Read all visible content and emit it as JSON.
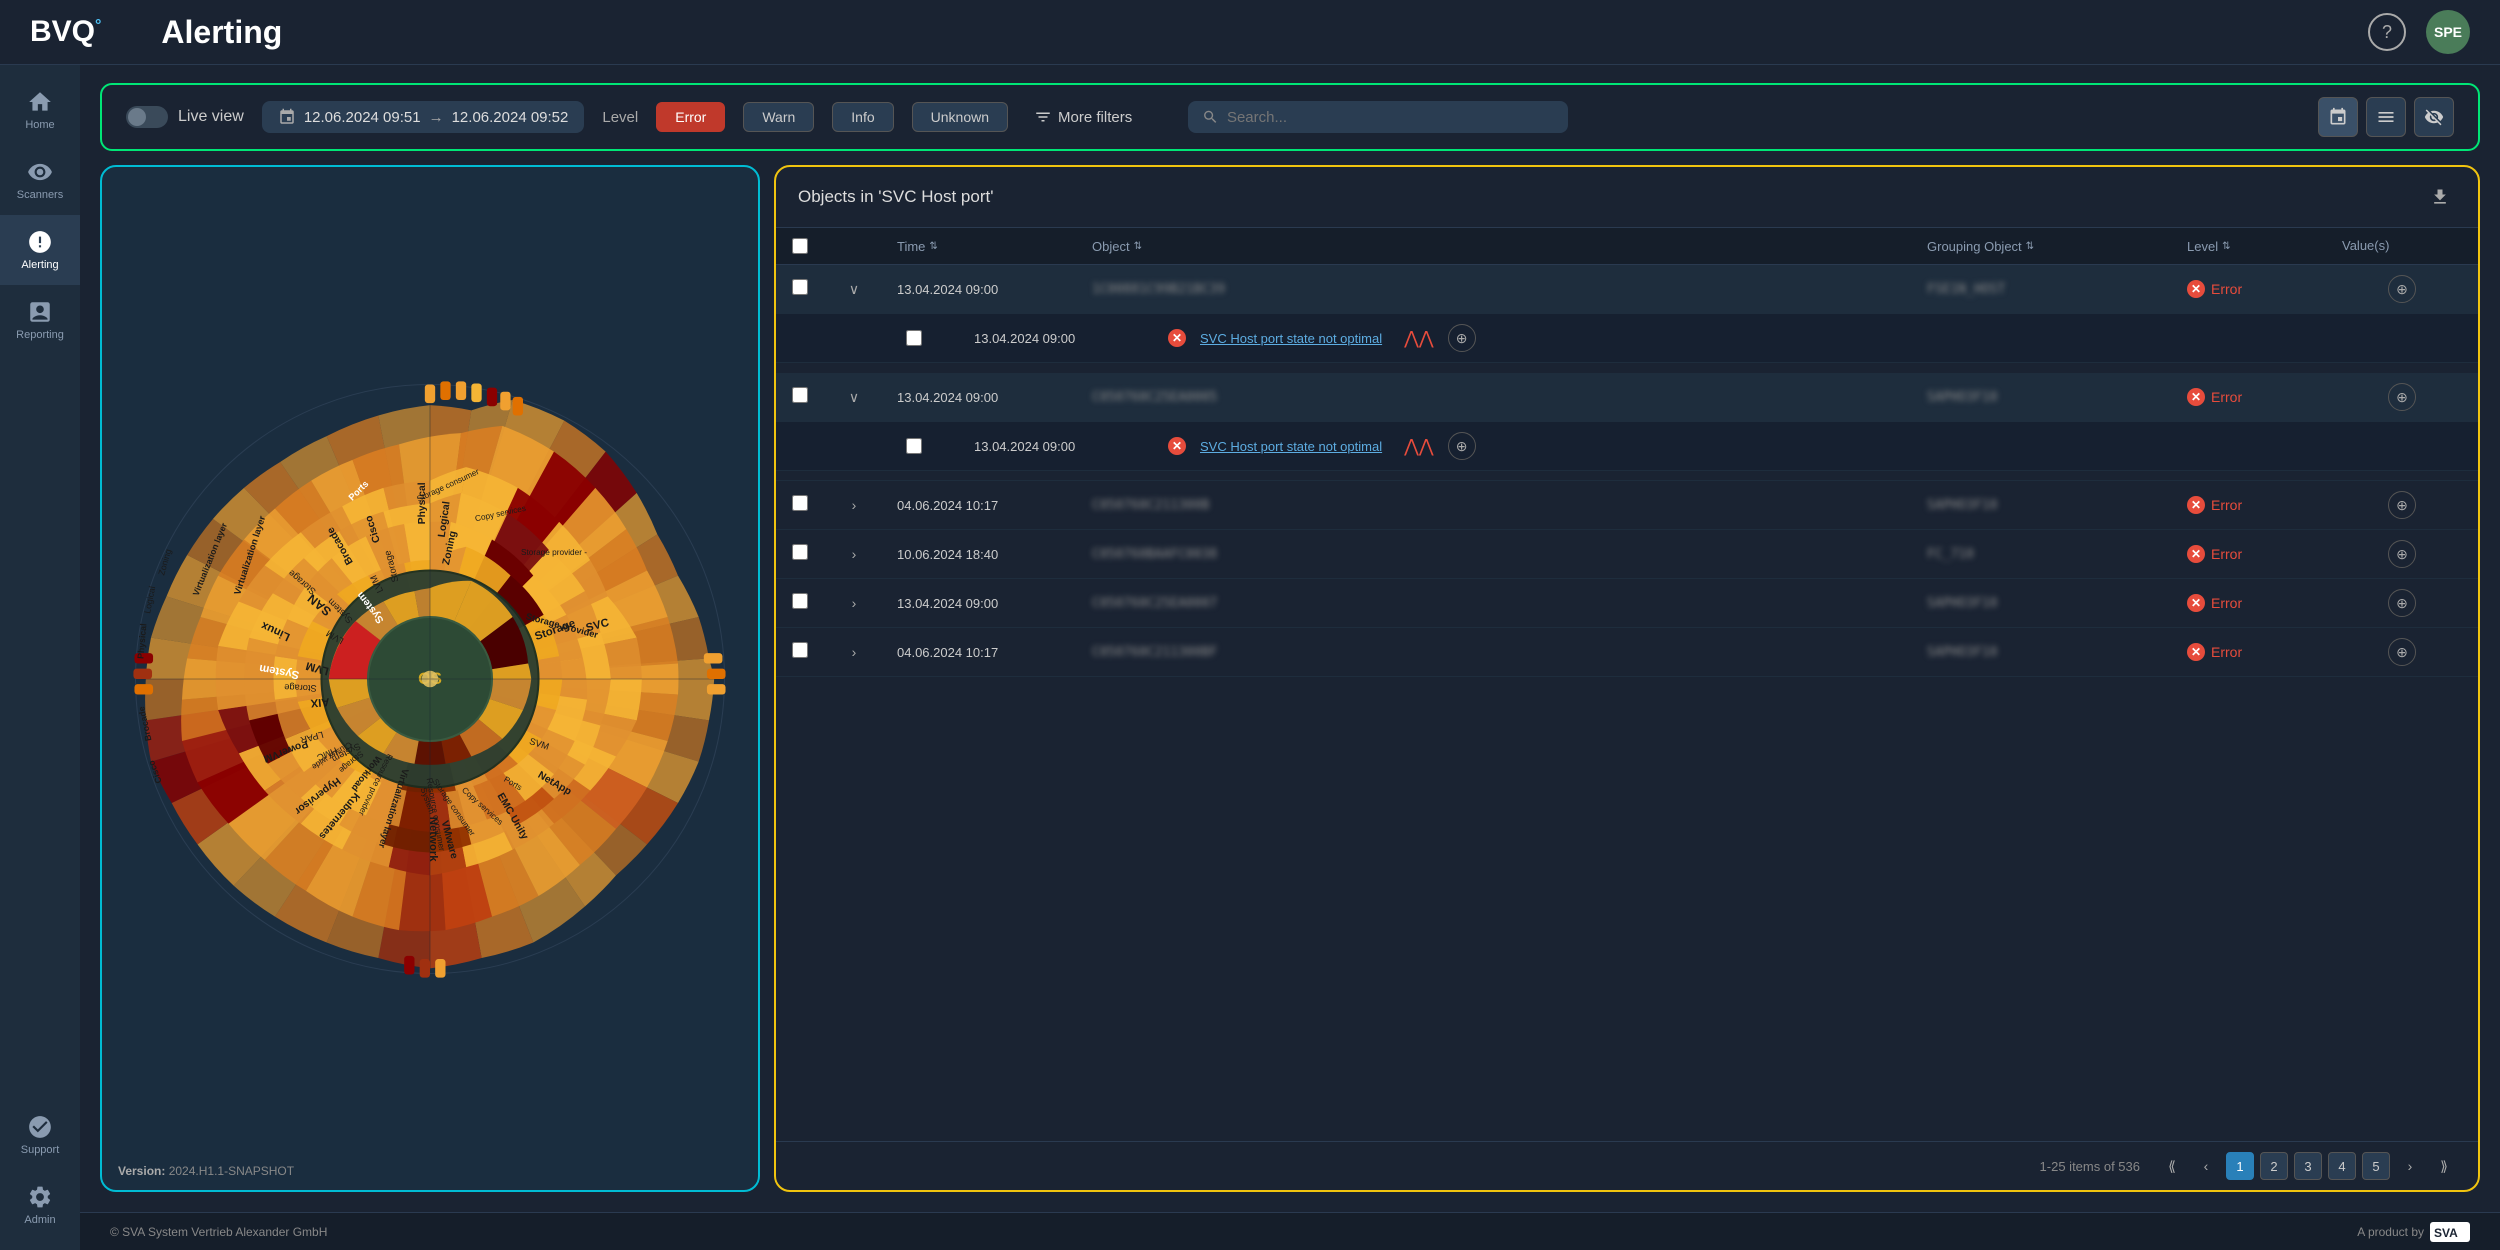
{
  "app": {
    "logo": "BVQ",
    "logo_sup": "°",
    "title": "Alerting",
    "user_initials": "SPE"
  },
  "topbar": {
    "help_label": "?",
    "user_initials": "SPE"
  },
  "sidebar": {
    "items": [
      {
        "id": "home",
        "label": "Home",
        "icon": "home"
      },
      {
        "id": "scanners",
        "label": "Scanners",
        "icon": "scanners"
      },
      {
        "id": "alerting",
        "label": "Alerting",
        "icon": "alerting",
        "active": true
      },
      {
        "id": "reporting",
        "label": "Reporting",
        "icon": "reporting"
      },
      {
        "id": "support",
        "label": "Support",
        "icon": "support"
      },
      {
        "id": "admin",
        "label": "Admin",
        "icon": "admin"
      }
    ]
  },
  "filter_bar": {
    "live_view_label": "Live view",
    "date_from": "12.06.2024 09:51",
    "date_to": "12.06.2024 09:52",
    "arrow": "→",
    "level_label": "Level",
    "filters": [
      {
        "id": "error",
        "label": "Error",
        "active": true
      },
      {
        "id": "warn",
        "label": "Warn",
        "active": false
      },
      {
        "id": "info",
        "label": "Info",
        "active": false
      },
      {
        "id": "unknown",
        "label": "Unknown",
        "active": false
      }
    ],
    "more_filters_label": "More filters",
    "search_placeholder": "Search..."
  },
  "wheel": {
    "version_label": "Version:",
    "version_value": "2024.H1.1-SNAPSHOT"
  },
  "alert_panel": {
    "title": "Objects in 'SVC Host port'",
    "table": {
      "headers": [
        "",
        "",
        "Time",
        "Object",
        "Grouping Object",
        "Level",
        "Value(s)"
      ],
      "rows": [
        {
          "id": "row1",
          "expanded": true,
          "time": "13.04.2024 09:00",
          "object": "██████████████████",
          "grouping": "███████████",
          "level": "Error",
          "sub_rows": [
            {
              "time": "13.04.2024 09:00",
              "alert_text": "SVC Host port state not optimal",
              "level": "Error"
            }
          ]
        },
        {
          "id": "row2",
          "expanded": true,
          "time": "13.04.2024 09:00",
          "object": "████████████████",
          "grouping": "████████████",
          "level": "Error",
          "sub_rows": [
            {
              "time": "13.04.2024 09:00",
              "alert_text": "SVC Host port state not optimal",
              "level": "Error"
            }
          ]
        },
        {
          "id": "row3",
          "expanded": false,
          "time": "04.06.2024 10:17",
          "object": "████████████████",
          "grouping": "████████████",
          "level": "Error"
        },
        {
          "id": "row4",
          "expanded": false,
          "time": "10.06.2024 18:40",
          "object": "████████████████",
          "grouping": "█████████",
          "level": "Error"
        },
        {
          "id": "row5",
          "expanded": false,
          "time": "13.04.2024 09:00",
          "object": "████████████████",
          "grouping": "████████████",
          "level": "Error"
        },
        {
          "id": "row6",
          "expanded": false,
          "time": "04.06.2024 10:17",
          "object": "████████████████",
          "grouping": "████████████",
          "level": "Error"
        }
      ]
    },
    "pagination": {
      "info": "1-25 items of 536",
      "current_page": 1,
      "pages": [
        1,
        2,
        3,
        4,
        5
      ]
    }
  },
  "footer": {
    "copyright": "© SVA System Vertrieb Alexander GmbH",
    "product_label": "A product by"
  }
}
